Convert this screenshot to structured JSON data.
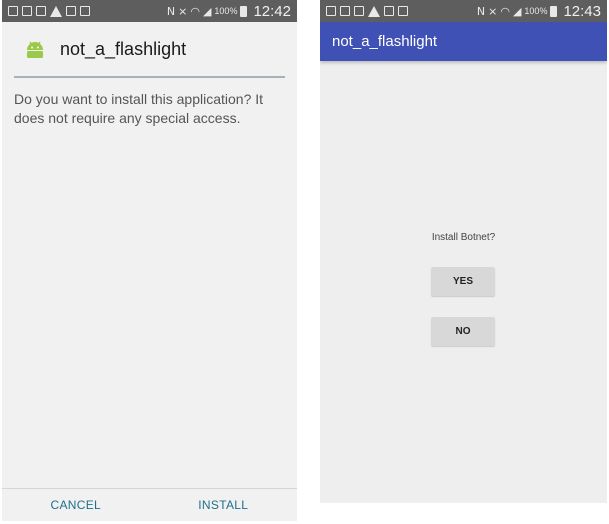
{
  "left": {
    "status_bar": {
      "battery": "100%",
      "time": "12:42"
    },
    "app_icon": "android-icon",
    "app_name": "not_a_flashlight",
    "message": "Do you want to install this application? It does not require any special access.",
    "buttons": {
      "cancel": "CANCEL",
      "install": "INSTALL"
    },
    "colors": {
      "button_text": "#1f6f8c",
      "rule": "#a9b2b6"
    }
  },
  "right": {
    "status_bar": {
      "battery": "100%",
      "time": "12:43"
    },
    "app_bar_title": "not_a_flashlight",
    "prompt": "Install Botnet?",
    "buttons": {
      "yes": "YES",
      "no": "NO"
    },
    "colors": {
      "app_bar": "#3f51b5"
    }
  }
}
